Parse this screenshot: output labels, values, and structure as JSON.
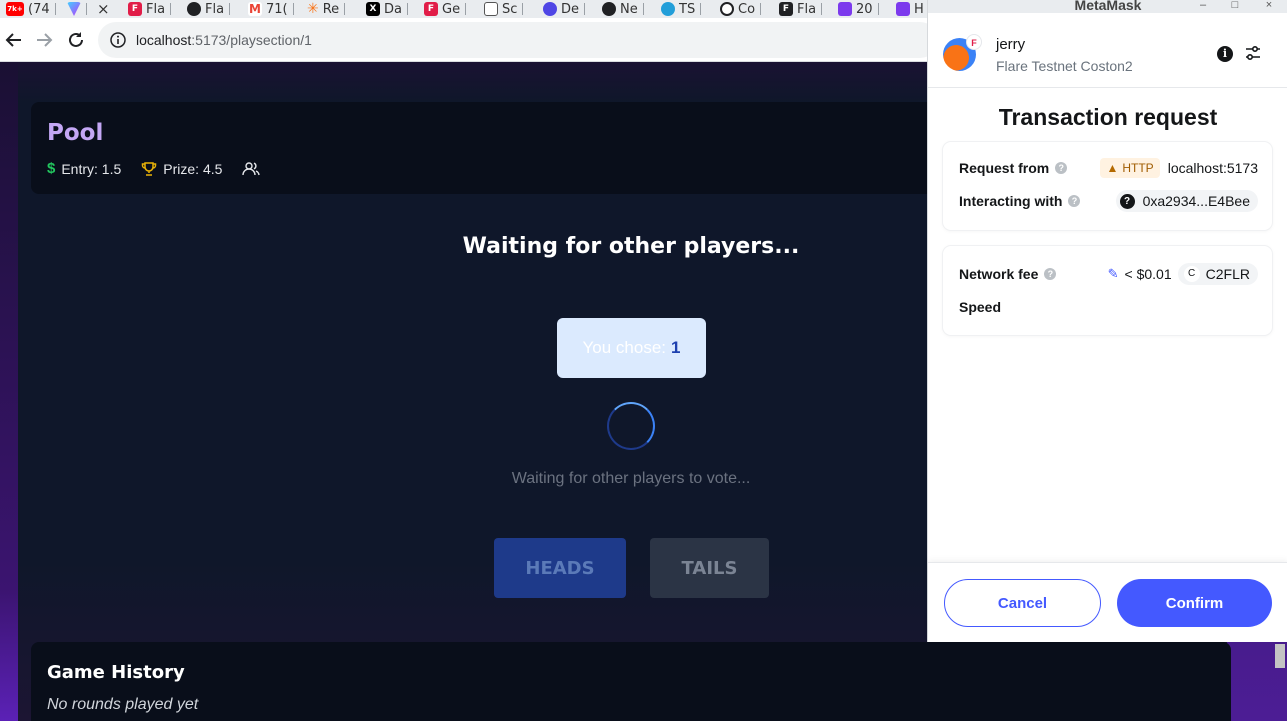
{
  "browser": {
    "tabs": [
      {
        "icon": "youtube-icon",
        "label": "(74",
        "color": "#ff0000",
        "badge": "7k+"
      },
      {
        "icon": "vite-icon",
        "label": "",
        "color": "#9b5cff"
      },
      {
        "icon": "close-icon",
        "label": "×",
        "color": "#202124"
      },
      {
        "icon": "flare-icon",
        "label": "Fla",
        "color": "#e11d48"
      },
      {
        "icon": "github-icon",
        "label": "Fla",
        "color": "#202124"
      },
      {
        "icon": "gmail-icon",
        "label": "71(",
        "color": "#ea4335"
      },
      {
        "icon": "star-icon",
        "label": "Re",
        "color": "#f97316"
      },
      {
        "icon": "x-icon",
        "label": "Da",
        "color": "#000000"
      },
      {
        "icon": "flare-icon",
        "label": "Ge",
        "color": "#e11d48"
      },
      {
        "icon": "screen-icon",
        "label": "Sc",
        "color": "#555555"
      },
      {
        "icon": "globe-icon",
        "label": "De",
        "color": "#4f46e5"
      },
      {
        "icon": "github-icon",
        "label": "Ne",
        "color": "#202124"
      },
      {
        "icon": "telegram-icon",
        "label": "TS",
        "color": "#229ed9"
      },
      {
        "icon": "circle-icon",
        "label": "Co",
        "color": "#202124"
      },
      {
        "icon": "flare-icon",
        "label": "Fla",
        "color": "#202124"
      },
      {
        "icon": "app-icon",
        "label": "20",
        "color": "#7c3aed"
      },
      {
        "icon": "app-icon",
        "label": "H",
        "color": "#7c3aed"
      }
    ],
    "url_host": "localhost",
    "url_path": ":5173/playsection/1"
  },
  "pool": {
    "title": "Pool",
    "entry": "Entry: 1.5",
    "prize": "Prize: 4.5"
  },
  "game": {
    "heading": "Waiting for other players...",
    "chose_label": "You chose:",
    "chose_value": "1",
    "waiting_text": "Waiting for other players to vote...",
    "heads_label": "HEADS",
    "tails_label": "TAILS"
  },
  "history": {
    "title": "Game History",
    "empty": "No rounds played yet"
  },
  "metamask": {
    "window_title": "MetaMask",
    "account_name": "jerry",
    "network_name": "Flare Testnet Coston2",
    "network_badge": "F",
    "heading": "Transaction request",
    "request_from_label": "Request from",
    "protocol": "HTTP",
    "request_origin": "localhost:5173",
    "interacting_label": "Interacting with",
    "contract_address": "0xa2934...E4Bee",
    "network_fee_label": "Network fee",
    "fee_value": "< $0.01",
    "token_symbol": "C2FLR",
    "token_letter": "C",
    "speed_label": "Speed",
    "cancel_label": "Cancel",
    "confirm_label": "Confirm",
    "accent_color": "#4459ff"
  }
}
